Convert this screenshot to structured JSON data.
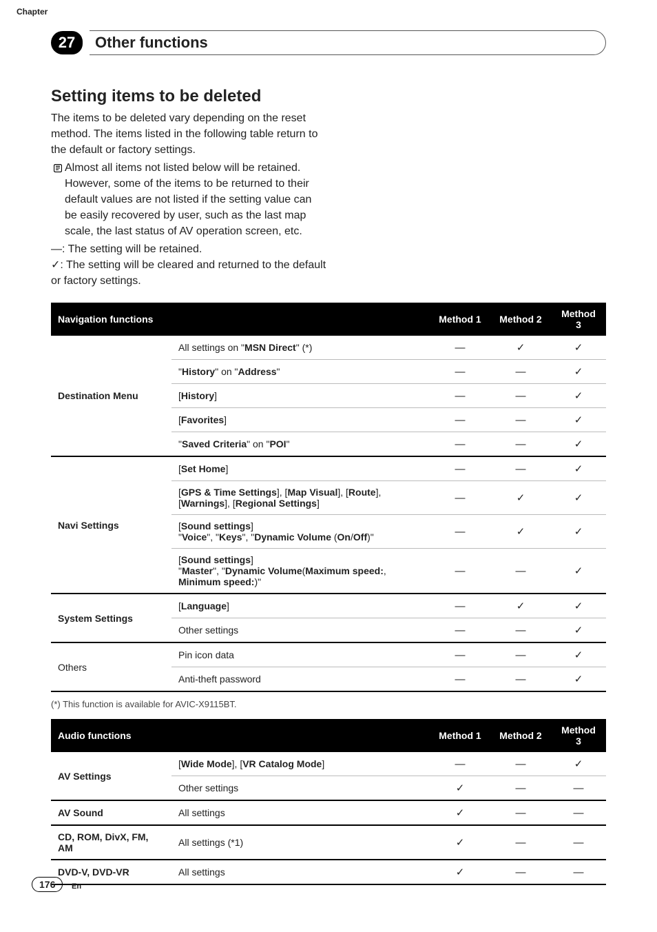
{
  "chapter_label": "Chapter",
  "chapter_number": "27",
  "chapter_title": "Other functions",
  "section_title": "Setting items to be deleted",
  "intro_p1": "The items to be deleted vary depending on the reset method. The items listed in the following table return to the default or factory settings.",
  "intro_bullet": "Almost all items not listed below will be retained. However, some of the items to be returned to their default values are not listed if the setting value can be easily recovered by user, such as the last map scale, the last status of AV operation screen, etc.",
  "legend_dash": "—: The setting will be retained.",
  "legend_check": "✓: The setting will be cleared and returned to the default or factory settings.",
  "table1": {
    "h_group": "Navigation functions",
    "h_col1": "",
    "h_m1": "Method 1",
    "h_m2": "Method 2",
    "h_m3": "Method 3",
    "footnote": "(*) This function is available for AVIC-X9115BT.",
    "groups": [
      {
        "name": "Destination Menu",
        "rows": [
          {
            "item_html": "All settings on \"<b>MSN Direct</b>\" (*)",
            "m1": "—",
            "m2": "✓",
            "m3": "✓"
          },
          {
            "item_html": "\"<b>History</b>\" on \"<b>Address</b>\"",
            "m1": "—",
            "m2": "—",
            "m3": "✓"
          },
          {
            "item_html": "[<b>History</b>]",
            "m1": "—",
            "m2": "—",
            "m3": "✓"
          },
          {
            "item_html": "[<b>Favorites</b>]",
            "m1": "—",
            "m2": "—",
            "m3": "✓"
          },
          {
            "item_html": "\"<b>Saved Criteria</b>\" on \"<b>POI</b>\"",
            "m1": "—",
            "m2": "—",
            "m3": "✓"
          }
        ]
      },
      {
        "name": "Navi Settings",
        "rows": [
          {
            "item_html": "[<b>Set Home</b>]",
            "m1": "—",
            "m2": "—",
            "m3": "✓"
          },
          {
            "item_html": "[<b>GPS & Time Settings</b>], [<b>Map Visual</b>], [<b>Route</b>], [<b>Warnings</b>], [<b>Regional Settings</b>]",
            "m1": "—",
            "m2": "✓",
            "m3": "✓"
          },
          {
            "item_html": "[<b>Sound settings</b>]<br>\"<b>Voice</b>\", \"<b>Keys</b>\", \"<b>Dynamic Volume</b> (<b>On</b>/<b>Off</b>)\"",
            "m1": "—",
            "m2": "✓",
            "m3": "✓"
          },
          {
            "item_html": "[<b>Sound settings</b>]<br>\"<b>Master</b>\", \"<b>Dynamic Volume</b>(<b>Maximum speed:</b>, <b>Minimum speed:</b>)\"",
            "m1": "—",
            "m2": "—",
            "m3": "✓"
          }
        ]
      },
      {
        "name": "System Settings",
        "rows": [
          {
            "item_html": "[<b>Language</b>]",
            "m1": "—",
            "m2": "✓",
            "m3": "✓"
          },
          {
            "item_html": "Other settings",
            "m1": "—",
            "m2": "—",
            "m3": "✓"
          }
        ]
      },
      {
        "name": "Others",
        "name_bold": false,
        "rows": [
          {
            "item_html": "Pin icon data",
            "m1": "—",
            "m2": "—",
            "m3": "✓"
          },
          {
            "item_html": "Anti-theft password",
            "m1": "—",
            "m2": "—",
            "m3": "✓"
          }
        ]
      }
    ]
  },
  "table2": {
    "h_group": "Audio functions",
    "h_col1": "",
    "h_m1": "Method 1",
    "h_m2": "Method 2",
    "h_m3": "Method 3",
    "groups": [
      {
        "name": "AV Settings",
        "rows": [
          {
            "item_html": "[<b>Wide Mode</b>], [<b>VR Catalog Mode</b>]",
            "m1": "—",
            "m2": "—",
            "m3": "✓"
          },
          {
            "item_html": "Other settings",
            "m1": "✓",
            "m2": "—",
            "m3": "—"
          }
        ]
      },
      {
        "name": "AV Sound",
        "rows": [
          {
            "item_html": "All settings",
            "m1": "✓",
            "m2": "—",
            "m3": "—"
          }
        ]
      },
      {
        "name": "CD, ROM, DivX, FM, AM",
        "rows": [
          {
            "item_html": "All settings (*1)",
            "m1": "✓",
            "m2": "—",
            "m3": "—"
          }
        ]
      },
      {
        "name": "DVD-V, DVD-VR",
        "rows": [
          {
            "item_html": "All settings",
            "m1": "✓",
            "m2": "—",
            "m3": "—"
          }
        ]
      }
    ]
  },
  "page_number": "176",
  "page_lang": "En"
}
